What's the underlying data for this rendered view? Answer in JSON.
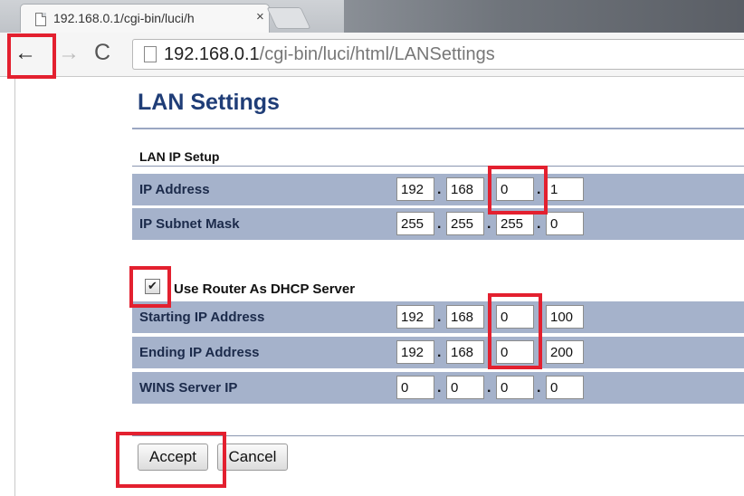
{
  "browser": {
    "tab_title": "192.168.0.1/cgi-bin/luci/h",
    "tab_close": "×",
    "url_host": "192.168.0.1",
    "url_path": "/cgi-bin/luci/html/LANSettings",
    "back_glyph": "←",
    "forward_glyph": "→",
    "reload_glyph": "C"
  },
  "page": {
    "title": "LAN Settings",
    "section_label": "LAN IP Setup",
    "lan_rows": [
      {
        "label": "IP Address",
        "octets": [
          "192",
          "168",
          "0",
          "1"
        ]
      },
      {
        "label": "IP Subnet Mask",
        "octets": [
          "255",
          "255",
          "255",
          "0"
        ]
      }
    ],
    "dhcp": {
      "checkbox_label": "Use Router As DHCP Server",
      "checked": true,
      "check_glyph": "✔"
    },
    "dhcp_rows": [
      {
        "label": "Starting IP Address",
        "octets": [
          "192",
          "168",
          "0",
          "100"
        ]
      },
      {
        "label": "Ending IP Address",
        "octets": [
          "192",
          "168",
          "0",
          "200"
        ]
      },
      {
        "label": "WINS Server IP",
        "octets": [
          "0",
          "0",
          "0",
          "0"
        ]
      }
    ],
    "dot": ".",
    "buttons": {
      "accept": "Accept",
      "cancel": "Cancel"
    }
  },
  "colors": {
    "title": "#1f3d77",
    "row_bg": "#a5b2cb",
    "highlight": "#e3202f"
  },
  "icons": [
    "back-arrow-icon",
    "forward-arrow-icon",
    "reload-icon",
    "page-icon",
    "close-icon",
    "checkmark-icon"
  ]
}
